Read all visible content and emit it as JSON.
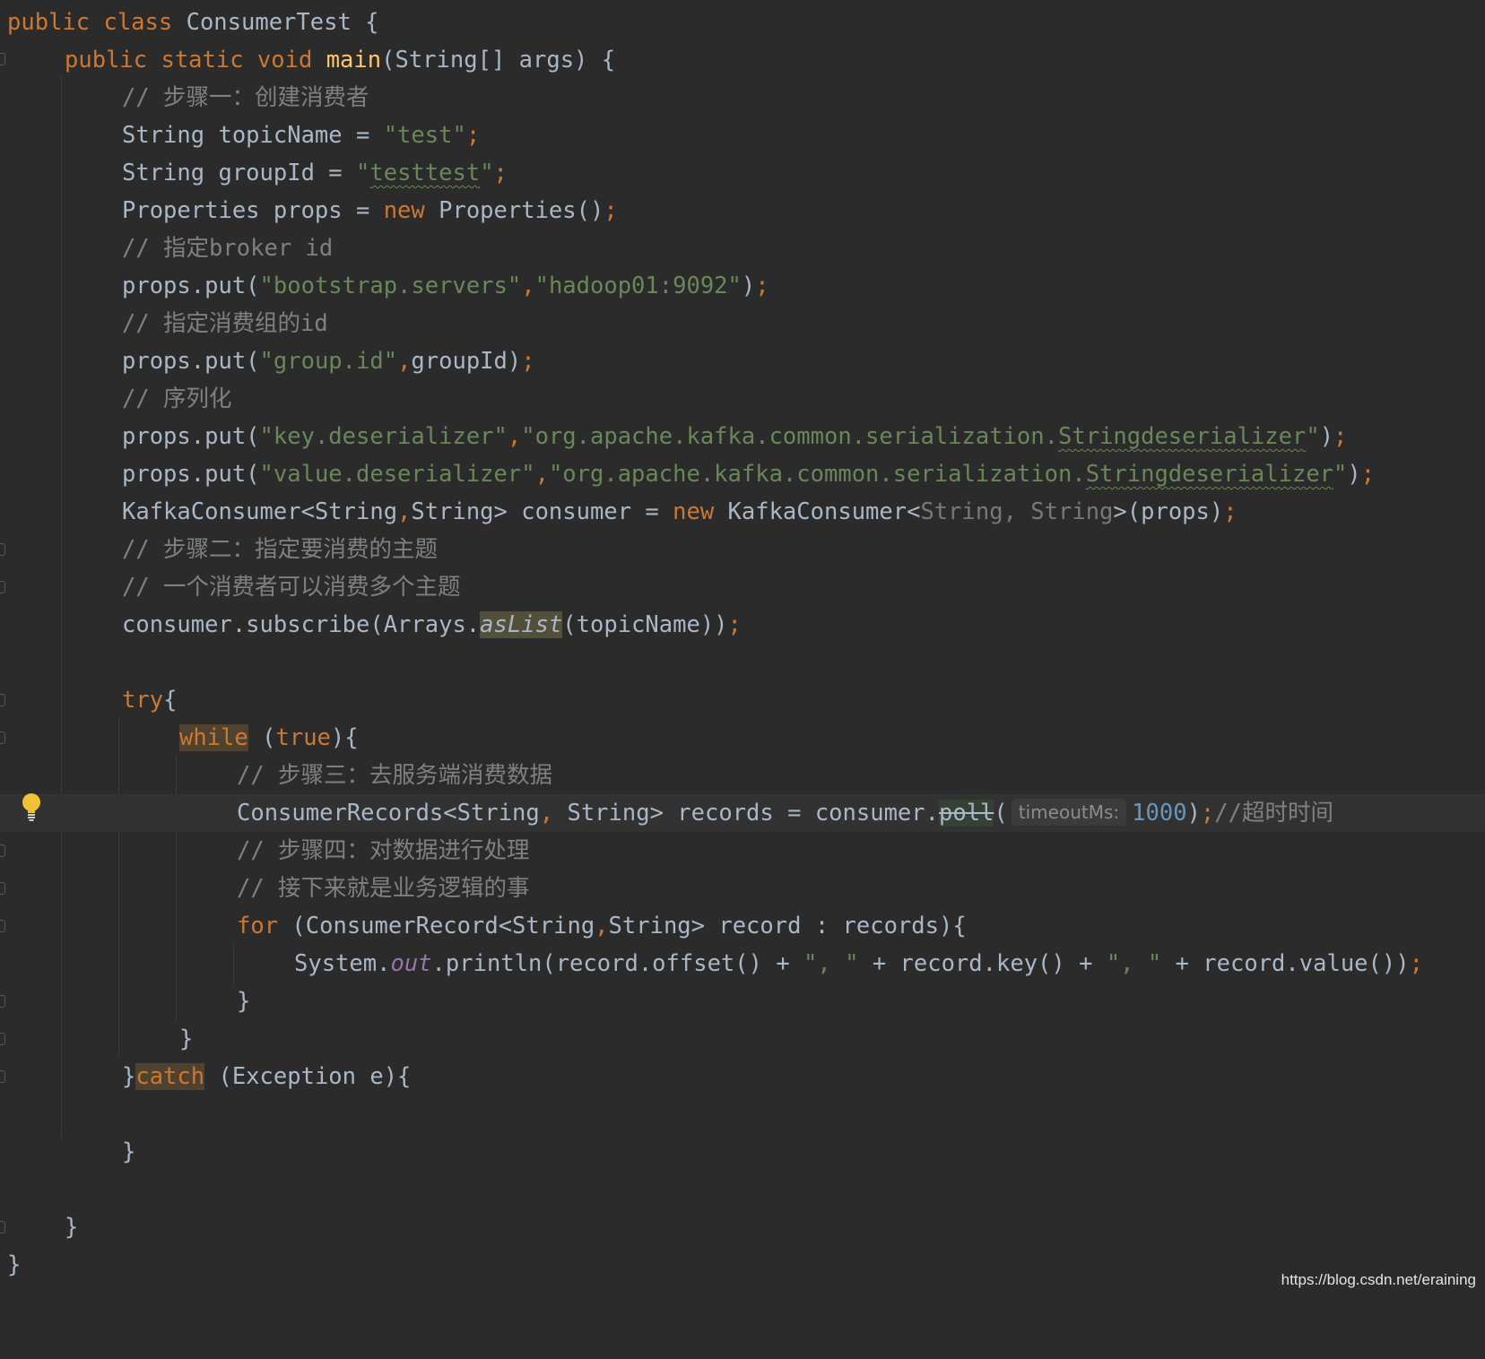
{
  "editor": {
    "lines": {
      "l1": {
        "kw1": "public class ",
        "name": "ConsumerTest",
        "rest": " {"
      },
      "l2": {
        "kw1": "public static void ",
        "fn": "main",
        "rest": "(String[] args) {"
      },
      "l3": {
        "comment": "// 步骤一：创建消费者"
      },
      "l4": {
        "pre": "String topicName = ",
        "str": "\"test\"",
        "semi": ";"
      },
      "l5": {
        "pre": "String groupId = ",
        "q1": "\"",
        "str": "testtest",
        "q2": "\"",
        "semi": ";"
      },
      "l6": {
        "pre": "Properties props = ",
        "kw": "new",
        "post": " Properties()",
        "semi": ";"
      },
      "l7": {
        "comment": "// 指定broker id"
      },
      "l8": {
        "pre": "props.put(",
        "s1": "\"bootstrap.servers\"",
        "comma": ",",
        "s2": "\"hadoop01:9092\"",
        "post": ")",
        "semi": ";"
      },
      "l9": {
        "comment": "// 指定消费组的id"
      },
      "l10": {
        "pre": "props.put(",
        "s1": "\"group.id\"",
        "comma": ",",
        "post": "groupId)",
        "semi": ";"
      },
      "l11": {
        "comment": "// 序列化"
      },
      "l12": {
        "pre": "props.put(",
        "s1": "\"key.deserializer\"",
        "comma": ",",
        "s2a": "\"org.apache.kafka.common.serialization.",
        "s2b": "Stringdeserializer",
        "s2c": "\"",
        "post": ")",
        "semi": ";"
      },
      "l13": {
        "pre": "props.put(",
        "s1": "\"value.deserializer\"",
        "comma": ",",
        "s2a": "\"org.apache.kafka.common.serialization.",
        "s2b": "Stringdeserializer",
        "s2c": "\"",
        "post": ")",
        "semi": ";"
      },
      "l14": {
        "pre": "KafkaConsumer<String",
        "c1": ",",
        "mid": "String> consumer = ",
        "kw": "new",
        "post": " KafkaConsumer<",
        "dim": "String, String",
        "tail": ">(props)",
        "semi": ";"
      },
      "l15": {
        "comment": "// 步骤二：指定要消费的主题"
      },
      "l16": {
        "comment": "// 一个消费者可以消费多个主题"
      },
      "l17": {
        "pre": "consumer.subscribe(Arrays.",
        "call": "asList",
        "post": "(topicName))",
        "semi": ";"
      },
      "l19": {
        "kw": "try",
        "post": "{"
      },
      "l20": {
        "kw": "while",
        "mid": " (",
        "kw2": "true",
        "post": "){"
      },
      "l21": {
        "comment": "// 步骤三：去服务端消费数据"
      },
      "l22": {
        "pre": "ConsumerRecords<String",
        "c1": ",",
        "mid": " String> records = consumer.",
        "dep": "poll",
        "open": "(",
        "hint": "timeoutMs:",
        "num": "1000",
        "close": ")",
        "semi": ";",
        "comment": "//超时时间"
      },
      "l23": {
        "comment": "// 步骤四：对数据进行处理"
      },
      "l24": {
        "comment": "// 接下来就是业务逻辑的事"
      },
      "l25": {
        "kw": "for",
        "mid": " (ConsumerRecord<String",
        "c1": ",",
        "post": "String> record : records){"
      },
      "l26": {
        "pre": "System.",
        "field": "out",
        "mid": ".println(record.offset() + ",
        "s1": "\", \"",
        "mid2": " + record.key() + ",
        "s2": "\", \"",
        "post": " + record.value())",
        "semi": ";"
      },
      "l27": {
        "text": "}"
      },
      "l28": {
        "text": "}"
      },
      "l29": {
        "brace": "}",
        "kw": "catch",
        "post": " (Exception e){"
      },
      "l31": {
        "text": "}"
      },
      "l33": {
        "text": "}"
      },
      "l34": {
        "text": "}"
      }
    }
  },
  "watermark": "https://blog.csdn.net/eraining",
  "colors": {
    "background": "#2b2b2b",
    "keyword": "#cc7832",
    "string": "#6a8759",
    "comment": "#808080",
    "number": "#6897bb",
    "method": "#ffc66d",
    "text": "#a9b7c6"
  },
  "icons": {
    "intention": "lightbulb-icon"
  }
}
